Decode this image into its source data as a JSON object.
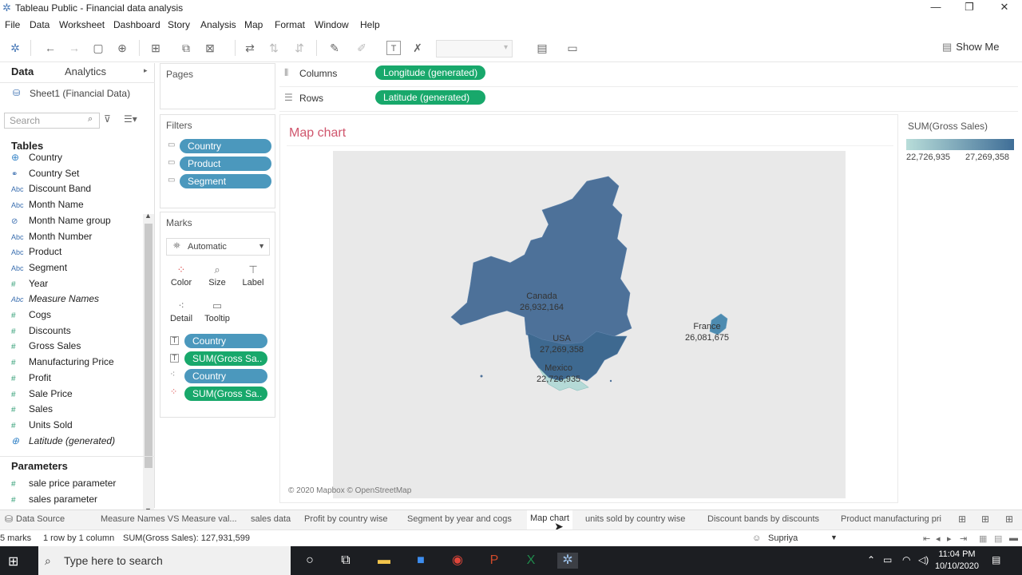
{
  "window": {
    "title": "Tableau Public - Financial data analysis"
  },
  "menu": [
    "File",
    "Data",
    "Worksheet",
    "Dashboard",
    "Story",
    "Analysis",
    "Map",
    "Format",
    "Window",
    "Help"
  ],
  "toolbar": {
    "show_me": "Show Me"
  },
  "data_pane": {
    "tab_data": "Data",
    "tab_analytics": "Analytics",
    "datasource": "Sheet1 (Financial Data)",
    "search_placeholder": "Search",
    "tables_title": "Tables",
    "fields": [
      {
        "name": "Country",
        "type": "geo"
      },
      {
        "name": "Country Set",
        "type": "set"
      },
      {
        "name": "Discount Band",
        "type": "abc"
      },
      {
        "name": "Month Name",
        "type": "abc"
      },
      {
        "name": "Month Name group",
        "type": "group"
      },
      {
        "name": "Month Number",
        "type": "abc"
      },
      {
        "name": "Product",
        "type": "abc"
      },
      {
        "name": "Segment",
        "type": "abc"
      },
      {
        "name": "Year",
        "type": "num"
      },
      {
        "name": "Measure Names",
        "type": "abc"
      },
      {
        "name": "Cogs",
        "type": "num"
      },
      {
        "name": "Discounts",
        "type": "num"
      },
      {
        "name": "Gross Sales",
        "type": "num"
      },
      {
        "name": "Manufacturing Price",
        "type": "num"
      },
      {
        "name": "Profit",
        "type": "num"
      },
      {
        "name": "Sale Price",
        "type": "num"
      },
      {
        "name": "Sales",
        "type": "num"
      },
      {
        "name": "Units Sold",
        "type": "num"
      },
      {
        "name": "Latitude (generated)",
        "type": "geo"
      }
    ],
    "parameters_title": "Parameters",
    "parameters": [
      "sale price parameter",
      "sales parameter"
    ]
  },
  "cards": {
    "pages": "Pages",
    "filters": "Filters",
    "filter_pills": [
      "Country",
      "Product",
      "Segment"
    ],
    "marks": "Marks",
    "mark_type": "Automatic",
    "mark_buttons": [
      "Color",
      "Size",
      "Label",
      "Detail",
      "Tooltip"
    ],
    "mark_pills": [
      "Country",
      "SUM(Gross Sa..",
      "Country",
      "SUM(Gross Sa.."
    ]
  },
  "shelves": {
    "columns_label": "Columns",
    "columns_pill": "Longitude (generated)",
    "rows_label": "Rows",
    "rows_pill": "Latitude (generated)"
  },
  "viz": {
    "title": "Map chart",
    "attribution": "© 2020 Mapbox © OpenStreetMap",
    "labels": [
      {
        "country": "Canada",
        "value": "26,932,164"
      },
      {
        "country": "USA",
        "value": "27,269,358"
      },
      {
        "country": "Mexico",
        "value": "22,726,935"
      },
      {
        "country": "France",
        "value": "26,081,675"
      }
    ]
  },
  "legend": {
    "title": "SUM(Gross Sales)",
    "min": "22,726,935",
    "max": "27,269,358",
    "color_low": "#b8ddd9",
    "color_high": "#3f6e97"
  },
  "sheet_tabs": [
    "Data Source",
    "Measure Names VS Measure val...",
    "sales data",
    "Profit by country wise",
    "Segment by year and cogs",
    "Map chart",
    "units sold by country wise",
    "Discount bands by discounts",
    "Product manufacturing pri"
  ],
  "active_tab": "Map chart",
  "status": {
    "marks": "5 marks",
    "rows": "1 row by 1 column",
    "sum": "SUM(Gross Sales): 127,931,599",
    "user": "Supriya"
  },
  "taskbar": {
    "search": "Type here to search",
    "time": "11:04 PM",
    "date": "10/10/2020"
  }
}
